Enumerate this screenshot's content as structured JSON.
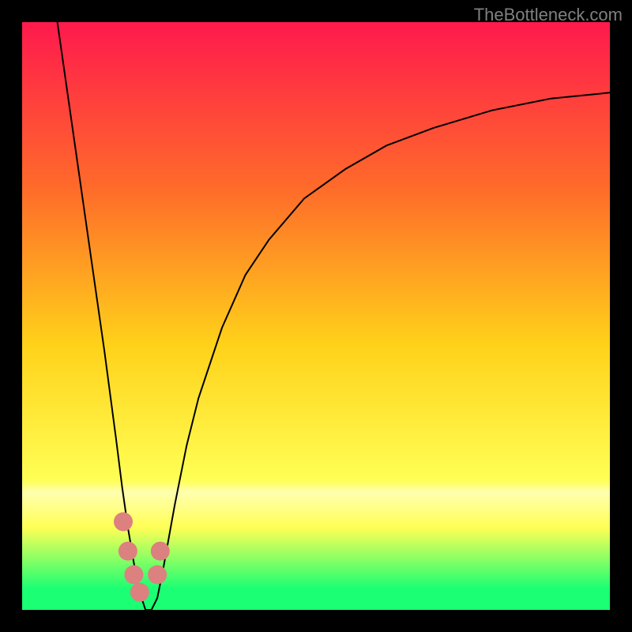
{
  "watermark": "TheBottleneck.com",
  "chart_data": {
    "type": "line",
    "title": "",
    "xlabel": "",
    "ylabel": "",
    "xlim": [
      0,
      100
    ],
    "ylim": [
      0,
      100
    ],
    "grid": false,
    "legend": false,
    "curve": {
      "x": [
        6,
        8,
        10,
        12,
        14,
        16,
        17,
        18,
        19,
        20,
        21,
        22,
        23,
        24,
        26,
        28,
        30,
        34,
        38,
        42,
        48,
        55,
        62,
        70,
        80,
        90,
        100
      ],
      "y": [
        100,
        86,
        72,
        58,
        44,
        29,
        21,
        14,
        8,
        3,
        0,
        0,
        2,
        7,
        18,
        28,
        36,
        48,
        57,
        63,
        70,
        75,
        79,
        82,
        85,
        87,
        88
      ]
    },
    "markers": {
      "color": "#dd8080",
      "points": [
        {
          "x": 17.2,
          "y": 15
        },
        {
          "x": 18.0,
          "y": 10
        },
        {
          "x": 19.0,
          "y": 6
        },
        {
          "x": 20.0,
          "y": 3
        },
        {
          "x": 23.0,
          "y": 6
        },
        {
          "x": 23.5,
          "y": 10
        }
      ]
    },
    "background_gradient": {
      "top_color": "#ff1a4d",
      "upper_mid_color": "#ff6a2a",
      "mid_color": "#ffd21a",
      "lower_mid_color": "#ffff55",
      "pale_band_color": "#ffffb0",
      "bottom_color": "#1aff73"
    }
  }
}
